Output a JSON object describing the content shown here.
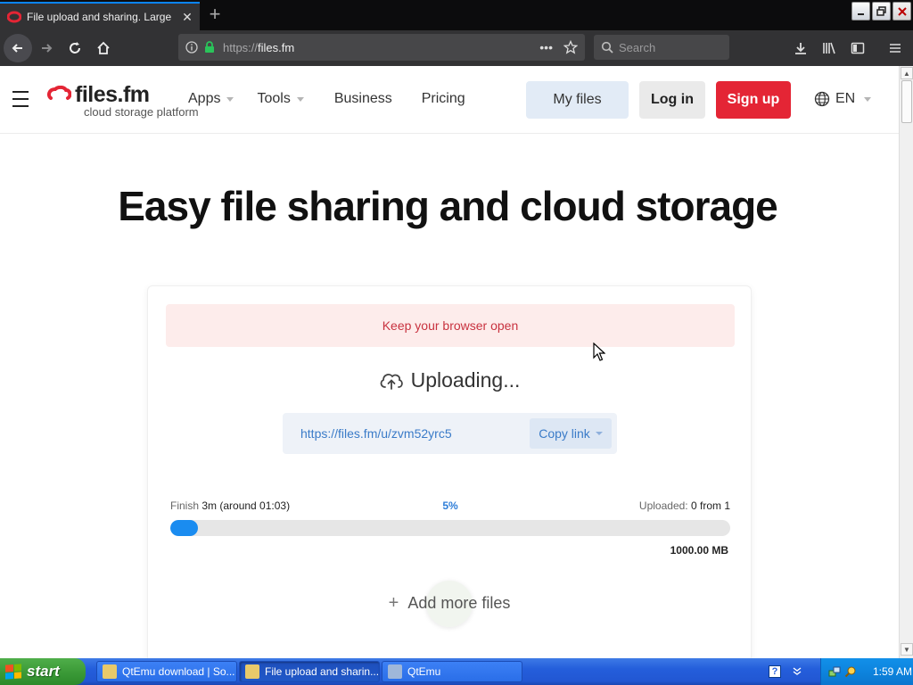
{
  "browser": {
    "tab_title": "File upload and sharing. Large file",
    "tab_close": "✕",
    "new_tab": "+",
    "url_protocol": "https://",
    "url_host": "files.fm",
    "url_menu": "•••",
    "search_placeholder": "Search"
  },
  "site": {
    "logo_name": "files.fm",
    "logo_tagline": "cloud storage platform",
    "menu": [
      {
        "label": "Apps",
        "dropdown": true
      },
      {
        "label": "Tools",
        "dropdown": true
      },
      {
        "label": "Business",
        "dropdown": false
      },
      {
        "label": "Pricing",
        "dropdown": false
      }
    ],
    "my_files": "My files",
    "login": "Log in",
    "signup": "Sign up",
    "language": "EN"
  },
  "hero": {
    "title": "Easy file sharing and cloud storage"
  },
  "upload": {
    "notice": "Keep your browser open",
    "status": "Uploading...",
    "link_url": "https://files.fm/u/zvm52yrc5",
    "copy_link": "Copy link",
    "finish_label": "Finish",
    "finish_value": "3m (around 01:03)",
    "percent_text": "5%",
    "progress": 0.05,
    "uploaded_label": "Uploaded:",
    "uploaded_value": "0 from 1",
    "size": "1000.00 MB",
    "add_more": "Add more files",
    "add_more_plus": "+"
  },
  "taskbar": {
    "start": "start",
    "tasks": [
      {
        "label": "QtEmu download | So...",
        "active": false
      },
      {
        "label": "File upload and sharin...",
        "active": true
      },
      {
        "label": "QtEmu",
        "active": false
      }
    ],
    "help": "?",
    "clock": "1:59 AM"
  },
  "colors": {
    "accent": "#0a84ff",
    "brand_red": "#e42535",
    "progress_blue": "#1a8cf0",
    "link_blue": "#3a7bc8"
  }
}
